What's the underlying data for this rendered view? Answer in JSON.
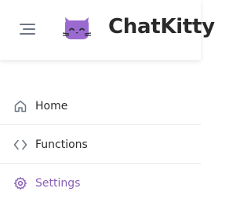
{
  "header": {
    "menu_icon": "hamburger-menu-icon",
    "logo_icon": "cat-logo-icon",
    "brand_name": "ChatKitty"
  },
  "sidebar": {
    "items": [
      {
        "label": "Home",
        "icon": "home-icon",
        "active": false
      },
      {
        "label": "Functions",
        "icon": "code-brackets-icon",
        "active": false
      },
      {
        "label": "Settings",
        "icon": "gear-icon",
        "active": true
      }
    ]
  },
  "colors": {
    "accent": "#8a5fb8",
    "icon_gray": "#6f7785",
    "text": "#2b2b2b",
    "logo_cat": "#9a6ad0"
  }
}
